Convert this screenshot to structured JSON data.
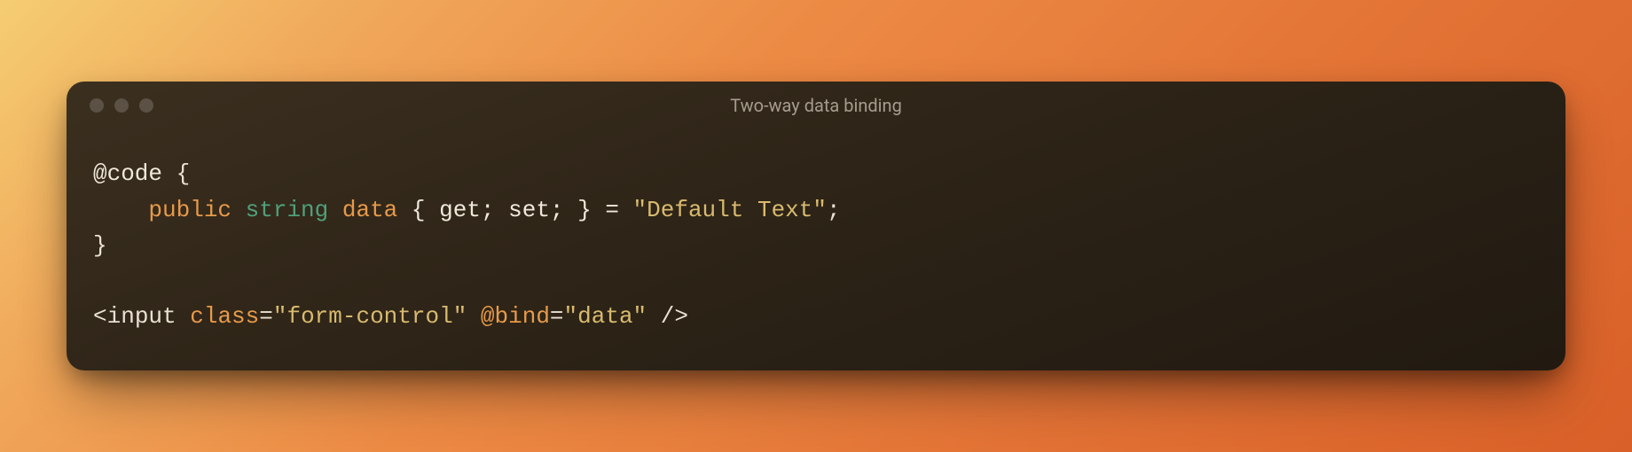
{
  "window": {
    "title": "Two-way data binding"
  },
  "code": {
    "line1_code": "@code",
    "line1_brace_open": " {",
    "line2_public": "public",
    "line2_string": "string",
    "line2_data": "data",
    "line2_accessors": " { get; set; } = ",
    "line2_literal": "\"Default Text\"",
    "line2_semicolon": ";",
    "line3_brace_close": "}",
    "line5_open": "<",
    "line5_tag": "input",
    "line5_sp1": " ",
    "line5_class_attr": "class",
    "line5_eq1": "=",
    "line5_class_val": "\"form-control\"",
    "line5_sp2": " ",
    "line5_bind_attr": "@bind",
    "line5_eq2": "=",
    "line5_bind_val": "\"data\"",
    "line5_close": " />"
  }
}
